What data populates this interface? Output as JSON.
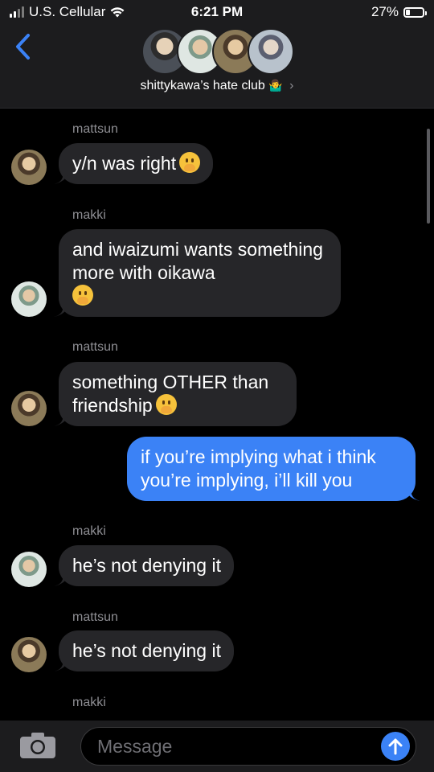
{
  "status_bar": {
    "carrier": "U.S. Cellular",
    "time": "6:21 PM",
    "battery_percent": "27%",
    "battery_level": 0.27,
    "signal_bars": 2
  },
  "header": {
    "back_icon": "chevron-left-icon",
    "group_name": "shittykawa’s hate club",
    "group_emoji": "🤷‍♂️",
    "chevron": "›"
  },
  "messages": [
    {
      "sender": "mattsun",
      "text": "y/n was right",
      "emoji": true,
      "from_me": false
    },
    {
      "sender": "makki",
      "text": "and iwaizumi wants something more with oikawa",
      "emoji": true,
      "from_me": false
    },
    {
      "sender": "mattsun",
      "text": "something OTHER than friendship",
      "emoji": true,
      "from_me": false
    },
    {
      "sender": "",
      "text": "if you’re implying what i think you’re implying, i’ll kill you",
      "emoji": false,
      "from_me": true
    },
    {
      "sender": "makki",
      "text": "he’s not denying it",
      "emoji": false,
      "from_me": false
    },
    {
      "sender": "mattsun",
      "text": "he’s not denying it",
      "emoji": false,
      "from_me": false
    },
    {
      "sender": "makki",
      "text": "",
      "emoji": false,
      "from_me": false
    }
  ],
  "composer": {
    "placeholder": "Message",
    "camera_icon": "camera-icon",
    "send_icon": "arrow-up-icon"
  },
  "colors": {
    "background": "#000000",
    "header": "#1c1c1e",
    "received_bubble": "#262629",
    "sent_bubble": "#3b82f6",
    "secondary_text": "#8e8e93"
  }
}
